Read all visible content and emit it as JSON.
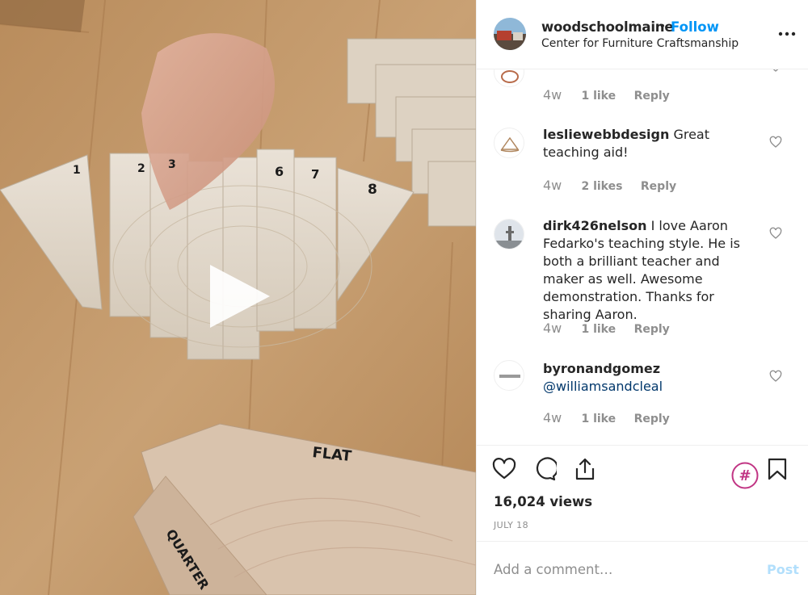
{
  "post": {
    "username": "woodschoolmaine",
    "separator": "•",
    "follow_label": "Follow",
    "location": "Center for Furniture Craftsmanship"
  },
  "video": {
    "block_numbers": [
      "1",
      "2",
      "3",
      "6",
      "7",
      "8"
    ],
    "label_flat": "FLAT",
    "label_quarter": "QUARTER"
  },
  "comments": [
    {
      "username": "",
      "text": "",
      "time": "4w",
      "likes": "1 like",
      "reply": "Reply"
    },
    {
      "username": "lesliewebbdesign",
      "text": " Great teaching aid!",
      "time": "4w",
      "likes": "2 likes",
      "reply": "Reply"
    },
    {
      "username": "dirk426nelson",
      "text": " I love Aaron Fedarko's teaching style. He is both a brilliant teacher and maker as well. Awesome demonstration. Thanks for sharing Aaron.",
      "time": "4w",
      "likes": "1 like",
      "reply": "Reply"
    },
    {
      "username": "byronandgomez",
      "text": "",
      "mention": "@williamsandcleal",
      "time": "4w",
      "likes": "1 like",
      "reply": "Reply"
    }
  ],
  "stats": {
    "views": "16,024 views",
    "date": "JULY 18"
  },
  "add_comment": {
    "placeholder": "Add a comment…",
    "post_label": "Post"
  },
  "colors": {
    "link_blue": "#0095f6",
    "muted": "#8e8e8e",
    "hashtag_magenta": "#c13584",
    "wood": "#c29a6c"
  },
  "icons": [
    "play-icon",
    "more-icon",
    "heart-icon",
    "comment-icon",
    "share-icon",
    "hashtag-icon",
    "bookmark-icon"
  ]
}
